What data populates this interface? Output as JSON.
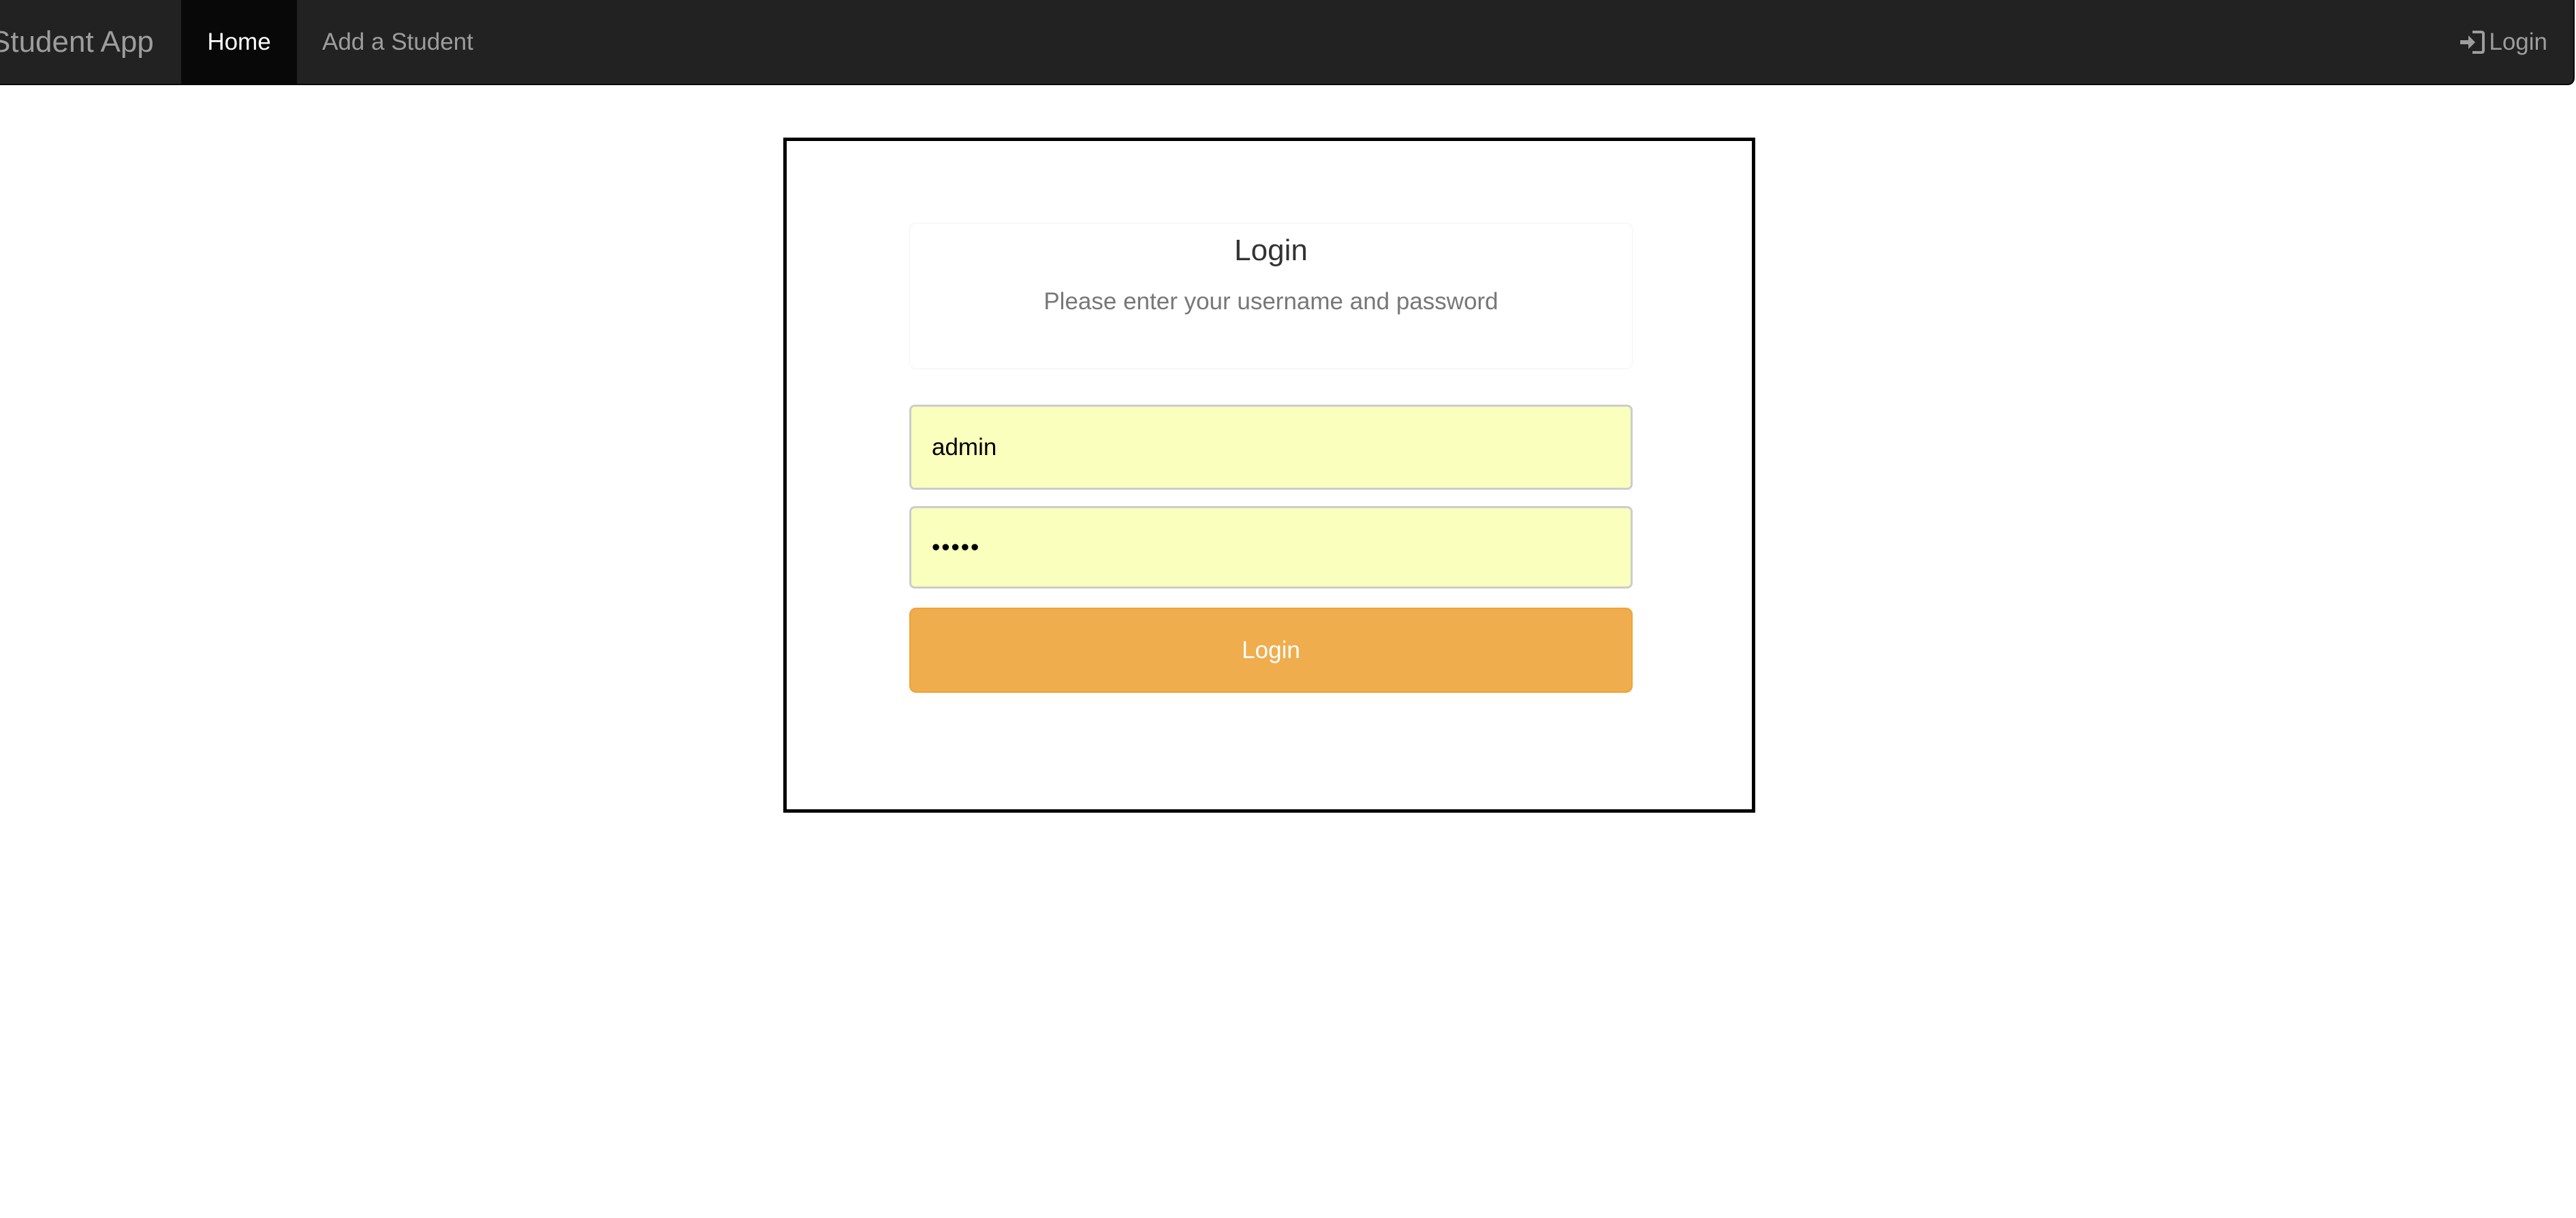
{
  "navbar": {
    "brand": "Student App",
    "items": [
      {
        "label": "Home",
        "active": true
      },
      {
        "label": "Add a Student",
        "active": false
      }
    ],
    "login_label": "Login",
    "login_icon": "sign-in-icon",
    "background_color": "#222222"
  },
  "login_panel": {
    "title": "Login",
    "subtitle": "Please enter your username and password",
    "username_value": "admin",
    "password_value": "•••••",
    "autofill_color": "#faffbd",
    "button_label": "Login",
    "button_color": "#f0ad4e"
  }
}
